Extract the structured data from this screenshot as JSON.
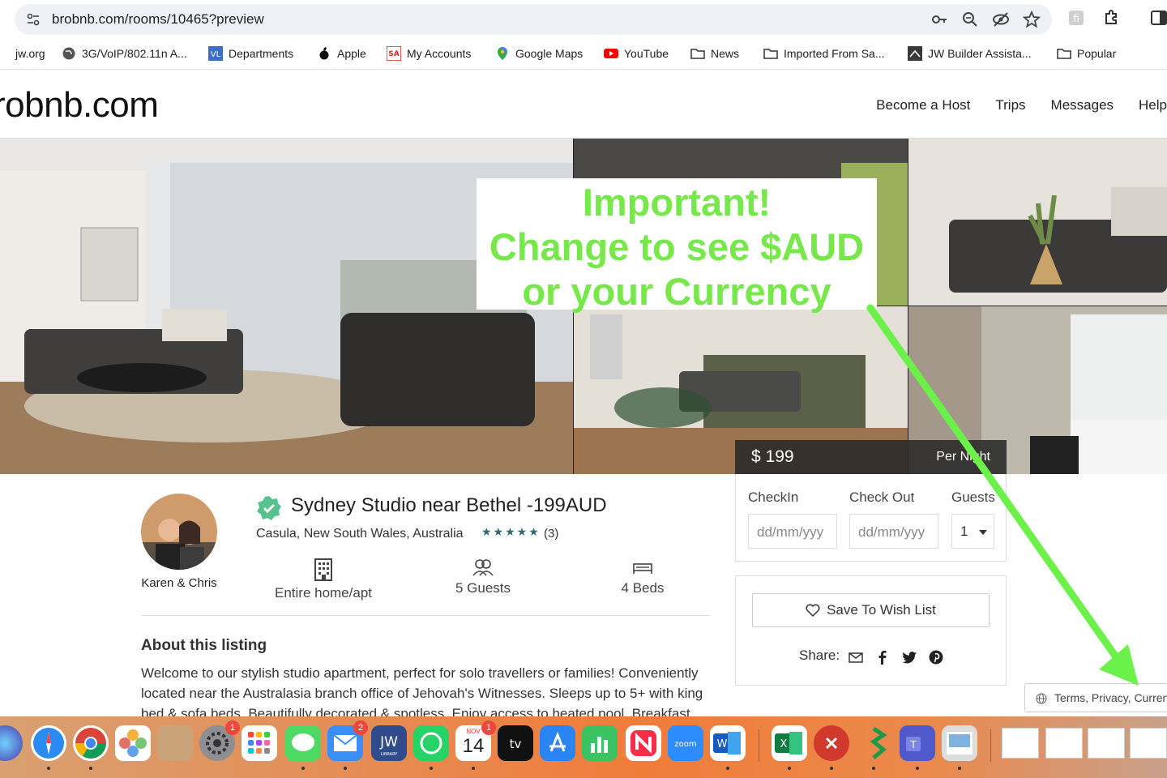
{
  "browser": {
    "url": "brobnb.com/rooms/10465?preview",
    "bookmarks": [
      {
        "label": "jw.org",
        "icon": "globe-icon"
      },
      {
        "label": "3G/VoIP/802.11n A...",
        "icon": "globe-icon"
      },
      {
        "label": "Departments",
        "icon": "vl-icon"
      },
      {
        "label": "Apple",
        "icon": "apple-icon"
      },
      {
        "label": "My Accounts",
        "icon": "sa-icon"
      },
      {
        "label": "Google Maps",
        "icon": "maps-icon"
      },
      {
        "label": "YouTube",
        "icon": "youtube-icon"
      },
      {
        "label": "News",
        "icon": "folder-icon"
      },
      {
        "label": "Imported From Sa...",
        "icon": "folder-icon"
      },
      {
        "label": "JW Builder Assista...",
        "icon": "jw-builder-icon"
      },
      {
        "label": "Popular",
        "icon": "folder-icon"
      }
    ]
  },
  "site": {
    "logo": "robnb.com",
    "nav": [
      "Become a Host",
      "Trips",
      "Messages",
      "Help"
    ]
  },
  "gallery": {
    "promo_lines": [
      "Important!",
      "Change to see $AUD",
      "or your Currency"
    ],
    "price": "$ 199",
    "per_night": "Per Night"
  },
  "listing": {
    "host_name": "Karen & Chris",
    "title": "Sydney Studio near Bethel -199AUD",
    "location": "Casula, New South Wales, Australia",
    "rating": 5,
    "stars": "★★★★★",
    "reviews": "(3)",
    "features": [
      {
        "label": "Entire home/apt",
        "icon": "building-icon"
      },
      {
        "label": "5 Guests",
        "icon": "guests-icon"
      },
      {
        "label": "4 Beds",
        "icon": "bed-icon"
      }
    ],
    "about_heading": "About this listing",
    "about_text": "Welcome to our stylish studio apartment, perfect for solo travellers or families! Conveniently located near the Australasia branch office of Jehovah's Witnesses. Sleeps up to 5+ with king bed & sofa beds. Beautifully decorated & spotless. Enjoy access to heated pool. Breakfast"
  },
  "booking": {
    "checkin_label": "CheckIn",
    "checkout_label": "Check Out",
    "guests_label": "Guests",
    "checkin_placeholder": "dd/mm/yyy",
    "checkout_placeholder": "dd/mm/yyy",
    "guests_value": "1",
    "wish_label": "Save To Wish List",
    "share_label": "Share:"
  },
  "footer": {
    "terms": "Terms, Privacy, Currency"
  },
  "dock": {
    "badges": {
      "settings": "1",
      "mail": "2",
      "calendar": "1"
    },
    "calendar_month": "NOV",
    "calendar_day": "14"
  },
  "colors": {
    "promo_green": "#76e84a",
    "arrow_green": "#6cf04a",
    "star_teal": "#2d6a74"
  }
}
